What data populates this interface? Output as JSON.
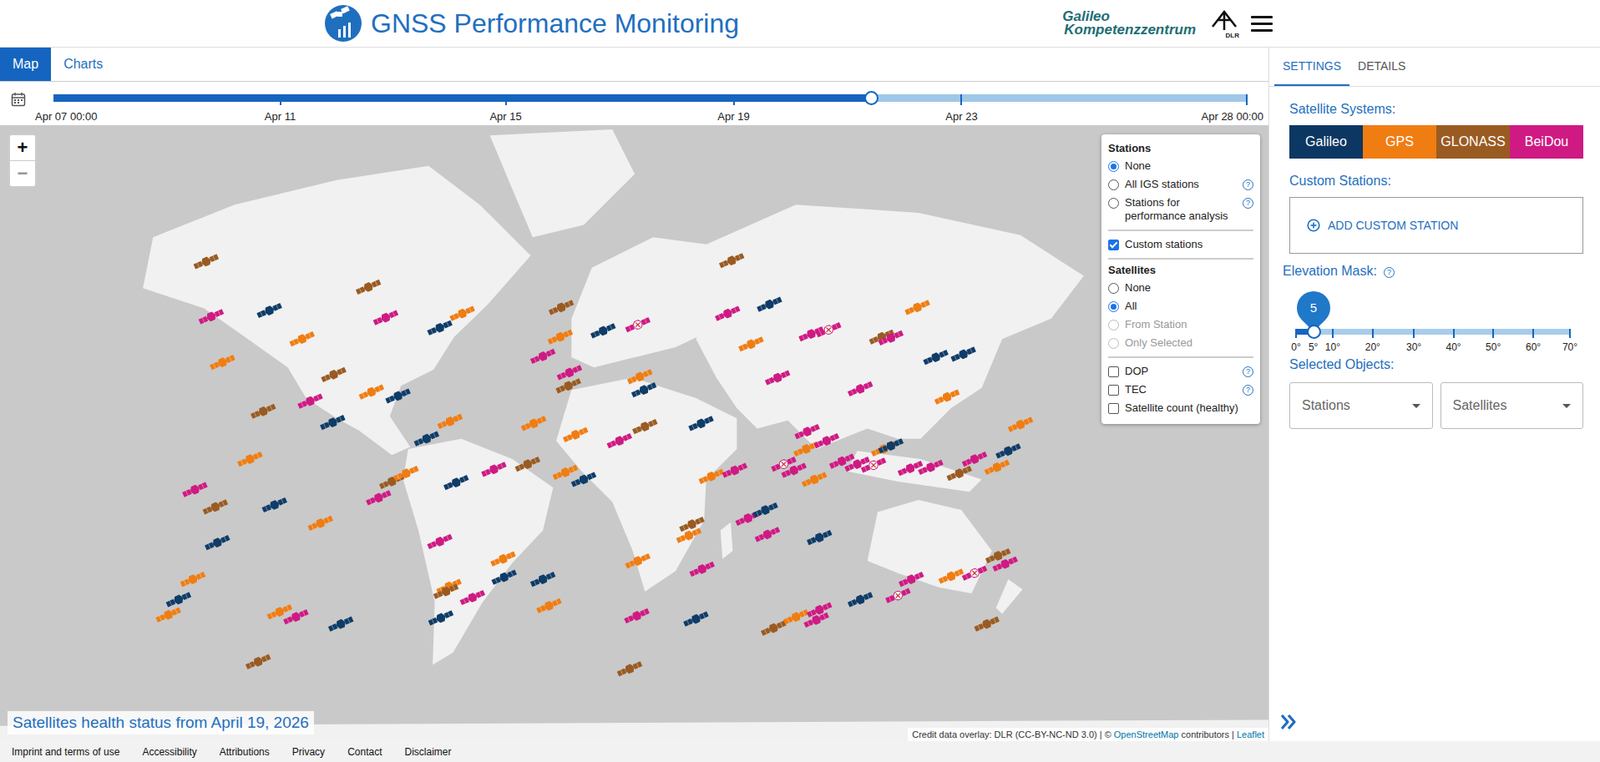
{
  "header": {
    "title": "GNSS Performance Monitoring",
    "partner": [
      "Galileo",
      "Kompetenzzentrum"
    ],
    "dlr": "DLR"
  },
  "tabs": [
    {
      "label": "Map",
      "selected": true
    },
    {
      "label": "Charts",
      "selected": false
    }
  ],
  "timeline": {
    "labels": [
      "Apr 07 00:00",
      "Apr 11",
      "Apr 15",
      "Apr 19",
      "Apr 23",
      "Apr 28 00:00"
    ],
    "level": 0.685
  },
  "help_glyph": "?",
  "map": {
    "zoom_in": "+",
    "zoom_out": "−",
    "caption": "Satellites health status from April 19, 2026",
    "attribution": {
      "prefix": "Credit data overlay: DLR (CC-BY-NC-ND 3.0) | © ",
      "osm": "OpenStreetMap",
      "middle": " contributors | ",
      "leaflet": "Leaflet"
    },
    "satellites": [
      {
        "color": "#9a5b22",
        "unhealthy": false
      },
      {
        "color": "#cf1a83",
        "unhealthy": false
      },
      {
        "color": "#0f3c68",
        "unhealthy": false
      },
      {
        "color": "#f07d12",
        "unhealthy": false
      },
      {
        "color": "#f07d12",
        "unhealthy": false
      },
      {
        "color": "#9a5b22",
        "unhealthy": false
      },
      {
        "color": "#cf1a83",
        "unhealthy": false
      },
      {
        "color": "#9a5b22",
        "unhealthy": false
      },
      {
        "color": "#9a5b22",
        "unhealthy": false
      },
      {
        "color": "#cf1a83",
        "unhealthy": false
      },
      {
        "color": "#f07d12",
        "unhealthy": false
      },
      {
        "color": "#0f3c68",
        "unhealthy": false
      },
      {
        "color": "#0f3c68",
        "unhealthy": false
      },
      {
        "color": "#f07d12",
        "unhealthy": false
      },
      {
        "color": "#cf1a83",
        "unhealthy": false
      },
      {
        "color": "#9a5b22",
        "unhealthy": false
      },
      {
        "color": "#0f3c68",
        "unhealthy": false
      },
      {
        "color": "#0f3c68",
        "unhealthy": false
      },
      {
        "color": "#f07d12",
        "unhealthy": false
      },
      {
        "color": "#f07d12",
        "unhealthy": false
      },
      {
        "color": "#0f3c68",
        "unhealthy": false
      },
      {
        "color": "#f07d12",
        "unhealthy": false
      },
      {
        "color": "#f07d12",
        "unhealthy": false
      },
      {
        "color": "#cf1a83",
        "unhealthy": false
      },
      {
        "color": "#0f3c68",
        "unhealthy": false
      },
      {
        "color": "#9a5b22",
        "unhealthy": false
      },
      {
        "color": "#0f3c68",
        "unhealthy": false
      },
      {
        "color": "#f07d12",
        "unhealthy": false
      },
      {
        "color": "#f07d12",
        "unhealthy": false
      },
      {
        "color": "#0f3c68",
        "unhealthy": false
      },
      {
        "color": "#0f3c68",
        "unhealthy": false
      },
      {
        "color": "#cf1a83",
        "unhealthy": false
      },
      {
        "color": "#9a5b22",
        "unhealthy": false
      },
      {
        "color": "#f07d12",
        "unhealthy": false
      },
      {
        "color": "#cf1a83",
        "unhealthy": false
      },
      {
        "color": "#cf1a83",
        "unhealthy": false
      },
      {
        "color": "#f07d12",
        "unhealthy": false
      },
      {
        "color": "#0f3c68",
        "unhealthy": false
      },
      {
        "color": "#f07d12",
        "unhealthy": false
      },
      {
        "color": "#9a5b22",
        "unhealthy": false
      },
      {
        "color": "#cf1a83",
        "unhealthy": false
      },
      {
        "color": "#0f3c68",
        "unhealthy": false
      },
      {
        "color": "#f07d12",
        "unhealthy": false
      },
      {
        "color": "#0f3c68",
        "unhealthy": false
      },
      {
        "color": "#9a5b22",
        "unhealthy": false
      },
      {
        "color": "#f07d12",
        "unhealthy": false
      },
      {
        "color": "#cf1a83",
        "unhealthy": false
      },
      {
        "color": "#cf1a83",
        "unhealthy": false
      },
      {
        "color": "#9a5b22",
        "unhealthy": false
      },
      {
        "color": "#0f3c68",
        "unhealthy": false
      },
      {
        "color": "#cf1a83",
        "unhealthy": true
      },
      {
        "color": "#f07d12",
        "unhealthy": false
      },
      {
        "color": "#0f3c68",
        "unhealthy": false
      },
      {
        "color": "#f07d12",
        "unhealthy": false
      },
      {
        "color": "#f07d12",
        "unhealthy": false
      },
      {
        "color": "#cf1a83",
        "unhealthy": false
      },
      {
        "color": "#9a5b22",
        "unhealthy": false
      },
      {
        "color": "#9a5b22",
        "unhealthy": false
      },
      {
        "color": "#f07d12",
        "unhealthy": false
      },
      {
        "color": "#0f3c68",
        "unhealthy": false
      },
      {
        "color": "#0f3c68",
        "unhealthy": false
      },
      {
        "color": "#f07d12",
        "unhealthy": false
      },
      {
        "color": "#cf1a83",
        "unhealthy": false
      },
      {
        "color": "#9a5b22",
        "unhealthy": false
      },
      {
        "color": "#f07d12",
        "unhealthy": false
      },
      {
        "color": "#f07d12",
        "unhealthy": false
      },
      {
        "color": "#cf1a83",
        "unhealthy": false
      },
      {
        "color": "#0f3c68",
        "unhealthy": false
      },
      {
        "color": "#cf1a83",
        "unhealthy": false
      },
      {
        "color": "#9a5b22",
        "unhealthy": false
      },
      {
        "color": "#9a5b22",
        "unhealthy": false
      },
      {
        "color": "#cf1a83",
        "unhealthy": false
      },
      {
        "color": "#0f3c68",
        "unhealthy": false
      },
      {
        "color": "#f07d12",
        "unhealthy": false
      },
      {
        "color": "#cf1a83",
        "unhealthy": false
      },
      {
        "color": "#cf1a83",
        "unhealthy": false
      },
      {
        "color": "#cf1a83",
        "unhealthy": true
      },
      {
        "color": "#cf1a83",
        "unhealthy": false
      },
      {
        "color": "#f07d12",
        "unhealthy": false
      },
      {
        "color": "#cf1a83",
        "unhealthy": false
      },
      {
        "color": "#cf1a83",
        "unhealthy": false
      },
      {
        "color": "#9a5b22",
        "unhealthy": false
      },
      {
        "color": "#cf1a83",
        "unhealthy": false
      },
      {
        "color": "#f07d12",
        "unhealthy": false
      },
      {
        "color": "#0f3c68",
        "unhealthy": false
      },
      {
        "color": "#0f3c68",
        "unhealthy": false
      },
      {
        "color": "#f07d12",
        "unhealthy": false
      },
      {
        "color": "#cf1a83",
        "unhealthy": true
      },
      {
        "color": "#cf1a83",
        "unhealthy": false
      },
      {
        "color": "#f07d12",
        "unhealthy": false
      },
      {
        "color": "#cf1a83",
        "unhealthy": false
      },
      {
        "color": "#cf1a83",
        "unhealthy": false
      },
      {
        "color": "#cf1a83",
        "unhealthy": true
      },
      {
        "color": "#f07d12",
        "unhealthy": false
      },
      {
        "color": "#0f3c68",
        "unhealthy": false
      },
      {
        "color": "#cf1a83",
        "unhealthy": false
      },
      {
        "color": "#cf1a83",
        "unhealthy": false
      },
      {
        "color": "#9a5b22",
        "unhealthy": false
      },
      {
        "color": "#cf1a83",
        "unhealthy": false
      },
      {
        "color": "#f07d12",
        "unhealthy": false
      },
      {
        "color": "#0f3c68",
        "unhealthy": false
      },
      {
        "color": "#f07d12",
        "unhealthy": false
      },
      {
        "color": "#cf1a83",
        "unhealthy": false
      },
      {
        "color": "#0f3c68",
        "unhealthy": false
      },
      {
        "color": "#cf1a83",
        "unhealthy": false
      },
      {
        "color": "#0f3c68",
        "unhealthy": false
      },
      {
        "color": "#9a5b22",
        "unhealthy": false
      },
      {
        "color": "#f07d12",
        "unhealthy": false
      },
      {
        "color": "#cf1a83",
        "unhealthy": false
      },
      {
        "color": "#cf1a83",
        "unhealthy": false
      },
      {
        "color": "#0f3c68",
        "unhealthy": false
      },
      {
        "color": "#cf1a83",
        "unhealthy": true
      },
      {
        "color": "#cf1a83",
        "unhealthy": false
      },
      {
        "color": "#f07d12",
        "unhealthy": false
      },
      {
        "color": "#cf1a83",
        "unhealthy": true
      },
      {
        "color": "#9a5b22",
        "unhealthy": false
      },
      {
        "color": "#cf1a83",
        "unhealthy": false
      },
      {
        "color": "#9a5b22",
        "unhealthy": false
      }
    ]
  },
  "legend": {
    "stations_title": "Stations",
    "stations": [
      {
        "label": "None",
        "selected": true,
        "help": false
      },
      {
        "label": "All IGS stations",
        "selected": false,
        "help": true
      },
      {
        "label": "Stations for performance analysis",
        "selected": false,
        "help": true
      }
    ],
    "custom": {
      "label": "Custom stations",
      "checked": true
    },
    "satellites_title": "Satellites",
    "satellites": [
      {
        "label": "None",
        "selected": false,
        "disabled": false
      },
      {
        "label": "All",
        "selected": true,
        "disabled": false
      },
      {
        "label": "From Station",
        "selected": false,
        "disabled": true
      },
      {
        "label": "Only Selected",
        "selected": false,
        "disabled": true
      }
    ],
    "overlays": [
      {
        "label": "DOP",
        "checked": false,
        "help": true
      },
      {
        "label": "TEC",
        "checked": false,
        "help": true
      },
      {
        "label": "Satellite count (healthy)",
        "checked": false,
        "help": false
      }
    ]
  },
  "side": {
    "tabs": [
      {
        "label": "SETTINGS",
        "selected": true
      },
      {
        "label": "DETAILS",
        "selected": false
      }
    ],
    "systems_label": "Satellite Systems:",
    "systems": [
      {
        "label": "Galileo",
        "color": "#0d3763",
        "selected": true
      },
      {
        "label": "GPS",
        "color": "#f07d12",
        "selected": true
      },
      {
        "label": "GLONASS",
        "color": "#9a5b22",
        "selected": true
      },
      {
        "label": "BeiDou",
        "color": "#cf1a83",
        "selected": true
      }
    ],
    "custom_label": "Custom Stations:",
    "add_button": "ADD CUSTOM STATION",
    "elevation": {
      "label": "Elevation Mask:",
      "value": "5",
      "level": 0.063,
      "ticks": [
        "0°",
        "5°",
        "10°",
        "20°",
        "30°",
        "40°",
        "50°",
        "60°",
        "70°"
      ]
    },
    "selected_label": "Selected Objects:",
    "dropdowns": [
      "Stations",
      "Satellites"
    ]
  },
  "footer": {
    "links": [
      "Imprint and terms of use",
      "Accessibility",
      "Attributions",
      "Privacy",
      "Contact",
      "Disclaimer"
    ]
  }
}
